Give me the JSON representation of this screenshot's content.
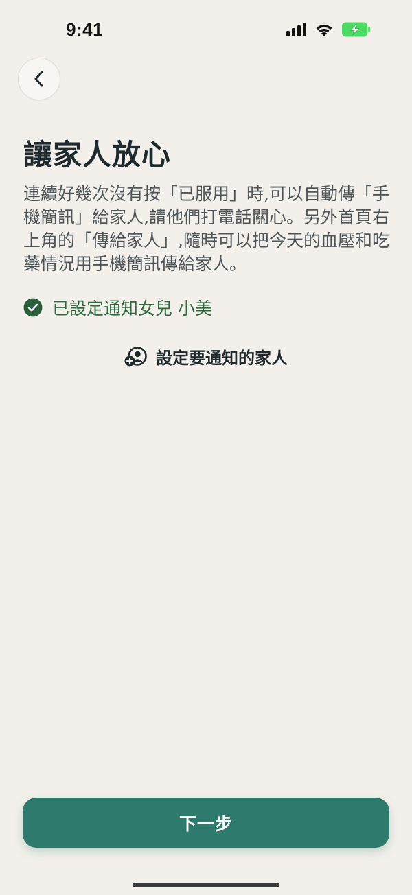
{
  "status_bar": {
    "time": "9:41",
    "battery_color": "#4cd964"
  },
  "header": {
    "back_icon": "chevron-left-icon"
  },
  "main": {
    "title": "讓家人放心",
    "description": "連續好幾次沒有按「已服用」時,可以自動傳「手機簡訊」給家人,請他們打電話關心。另外首頁右上角的「傳給家人」,隨時可以把今天的血壓和吃藥情況用手機簡訊傳給家人。",
    "notify_status": "已設定通知女兒 小美",
    "notify_color": "#2e6a3e",
    "set_family_label": "設定要通知的家人"
  },
  "footer": {
    "next_label": "下一步",
    "accent_color": "#2e7b6e"
  }
}
